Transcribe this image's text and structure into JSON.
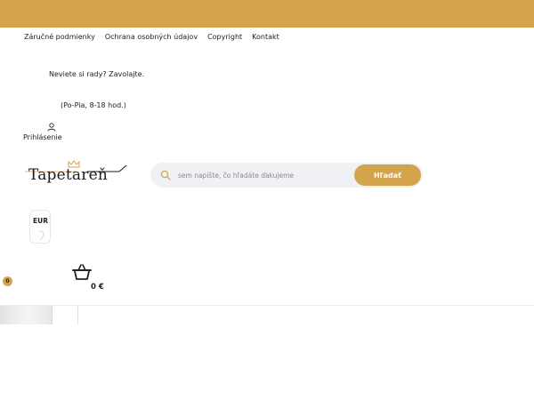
{
  "topbar": {
    "color": "#d4a44c"
  },
  "footer_links": [
    {
      "label": "Záručné podmienky"
    },
    {
      "label": "Ochrana osobných údajov"
    },
    {
      "label": "Copyright"
    },
    {
      "label": "Kontakt"
    }
  ],
  "contact": {
    "help_text": "Neviete si rady? Zavolajte.",
    "hours_text": "(Po-Pia, 8-18 hod.)"
  },
  "account": {
    "login_label": "Prihlásenie",
    "icon": "user-icon"
  },
  "brand": {
    "name": "Tapetareň",
    "icon": "crown-icon"
  },
  "search": {
    "placeholder": "sem napíšte, čo hľadáte ďakujeme",
    "value": "",
    "button_label": "Hľadať",
    "icon": "search-icon"
  },
  "currency": {
    "selected": "EUR"
  },
  "cart": {
    "count": "0",
    "total": "0 €",
    "icon": "basket-icon"
  },
  "colors": {
    "accent": "#d4a44c",
    "search_bg": "#f0f1f4"
  }
}
